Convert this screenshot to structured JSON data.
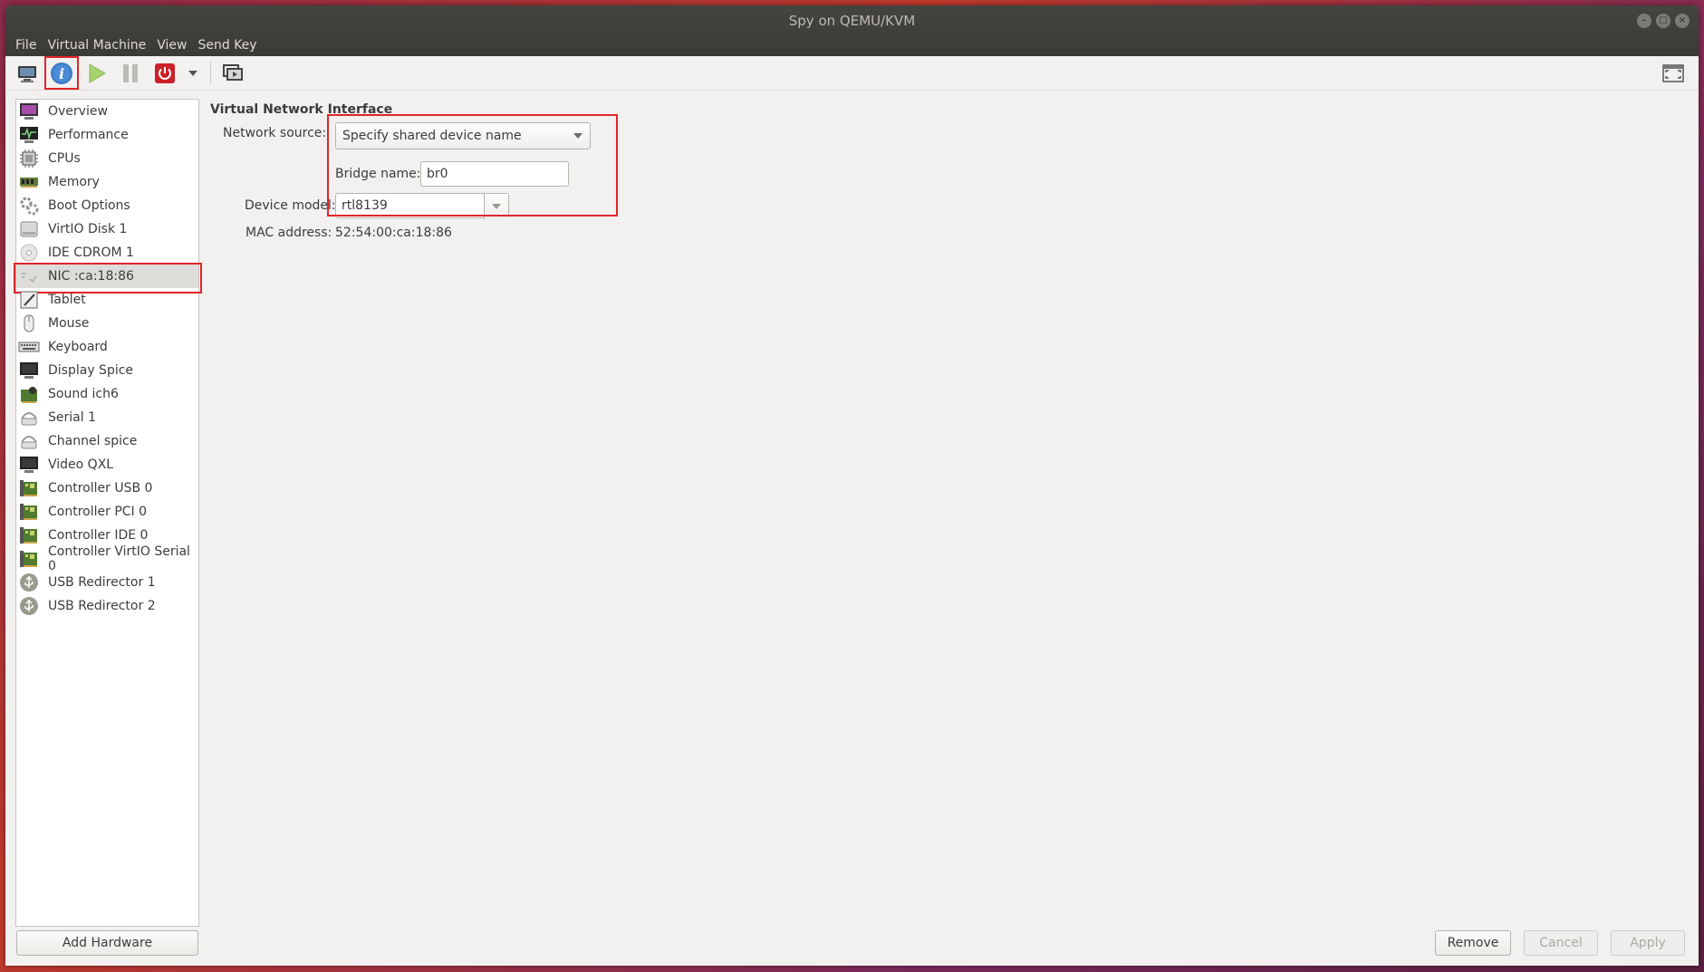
{
  "window": {
    "title": "Spy on QEMU/KVM"
  },
  "menu": [
    "File",
    "Virtual Machine",
    "View",
    "Send Key"
  ],
  "toolbar": {
    "buttons": [
      "console-icon",
      "info-icon",
      "run-icon",
      "pause-icon",
      "power-icon",
      "dropdown-icon",
      "screenshot-icon"
    ],
    "right_icon": "fullscreen-icon"
  },
  "sidebar": {
    "items": [
      {
        "label": "Overview",
        "icon": "overview-icon"
      },
      {
        "label": "Performance",
        "icon": "performance-icon"
      },
      {
        "label": "CPUs",
        "icon": "cpu-icon"
      },
      {
        "label": "Memory",
        "icon": "memory-icon"
      },
      {
        "label": "Boot Options",
        "icon": "boot-options-icon"
      },
      {
        "label": "VirtIO Disk 1",
        "icon": "disk-icon"
      },
      {
        "label": "IDE CDROM 1",
        "icon": "cdrom-icon"
      },
      {
        "label": "NIC :ca:18:86",
        "icon": "nic-icon"
      },
      {
        "label": "Tablet",
        "icon": "tablet-icon"
      },
      {
        "label": "Mouse",
        "icon": "mouse-icon"
      },
      {
        "label": "Keyboard",
        "icon": "keyboard-icon"
      },
      {
        "label": "Display Spice",
        "icon": "display-icon"
      },
      {
        "label": "Sound ich6",
        "icon": "sound-icon"
      },
      {
        "label": "Serial 1",
        "icon": "serial-icon"
      },
      {
        "label": "Channel spice",
        "icon": "channel-icon"
      },
      {
        "label": "Video QXL",
        "icon": "video-icon"
      },
      {
        "label": "Controller USB 0",
        "icon": "controller-icon"
      },
      {
        "label": "Controller PCI 0",
        "icon": "controller-icon"
      },
      {
        "label": "Controller IDE 0",
        "icon": "controller-icon"
      },
      {
        "label": "Controller VirtIO Serial 0",
        "icon": "controller-icon"
      },
      {
        "label": "USB Redirector 1",
        "icon": "usb-redirector-icon"
      },
      {
        "label": "USB Redirector 2",
        "icon": "usb-redirector-icon"
      }
    ],
    "selected": "NIC :ca:18:86",
    "add_hardware": "Add Hardware"
  },
  "details": {
    "section_title": "Virtual Network Interface",
    "network_source_label": "Network source:",
    "network_source_value": "Specify shared device name",
    "bridge_name_label": "Bridge name:",
    "bridge_name_value": "br0",
    "device_model_label": "Device model:",
    "device_model_value": "rtl8139",
    "mac_address_label": "MAC address:",
    "mac_address_value": "52:54:00:ca:18:86"
  },
  "footer": {
    "remove": "Remove",
    "cancel": "Cancel",
    "apply": "Apply"
  },
  "colors": {
    "highlight_box": "#e0242c",
    "selected_row": "#dedcd8",
    "titlebar": "#3b3a36"
  }
}
